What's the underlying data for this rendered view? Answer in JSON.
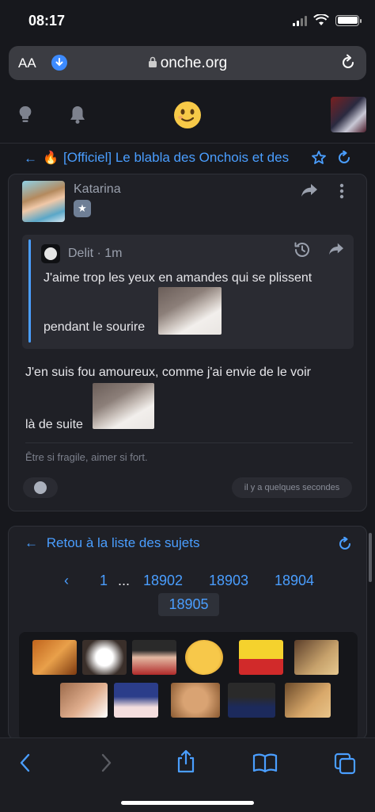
{
  "status": {
    "time": "08:17"
  },
  "browser": {
    "text_size_label": "AA",
    "url": "onche.org"
  },
  "topic": {
    "back_arrow": "←",
    "flame": "🔥",
    "title": "[Officiel] Le blabla des Onchois et des"
  },
  "post": {
    "author": "Katarina",
    "rank_glyph": "★",
    "quote": {
      "author": "Delit · 1m",
      "line1": "J'aime trop les yeux en amandes qui se plissent",
      "line2": "pendant le sourire"
    },
    "line1": "J'en suis fou amoureux, comme j'ai envie de le voir",
    "line2": "là de suite",
    "signature": "Être si fragile, aimer si fort.",
    "timestamp": "il y a quelques secondes"
  },
  "navigation": {
    "back_label": "Retou à la liste des sujets",
    "back_arrow": "←",
    "pagination": {
      "prev": "‹",
      "first": "1",
      "ellipsis": "...",
      "pages": [
        "18902",
        "18903",
        "18904"
      ],
      "current": "18905"
    }
  },
  "colors": {
    "accent": "#4a9eff",
    "background": "#17181d",
    "card": "#1f2026",
    "quote_bg": "#2a2b32"
  },
  "icons": [
    "lightbulb-icon",
    "bell-icon",
    "smiley-logo-icon",
    "share-icon",
    "more-icon",
    "history-icon",
    "star-icon",
    "refresh-icon",
    "back-icon",
    "forward-icon",
    "share-sheet-icon",
    "bookmarks-icon",
    "tabs-icon"
  ]
}
